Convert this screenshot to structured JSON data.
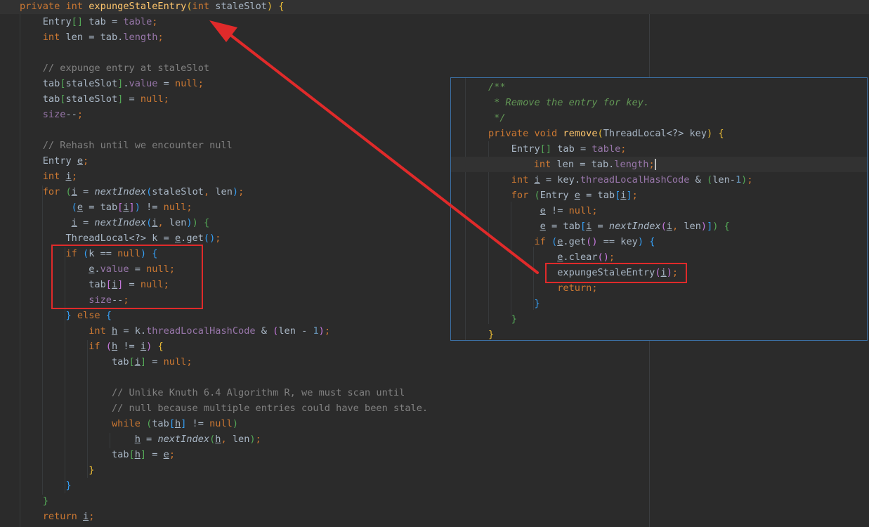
{
  "editor": {
    "main_code": [
      "<span class=\"kw\">private int </span><span class=\"fn\">expungeStaleEntry</span><span class=\"b1\">(</span><span class=\"kw\">int </span>staleSlot<span class=\"b1\">)</span> <span class=\"b1\">{</span>",
      "    Entry<span class=\"b2\">[]</span> tab = <span class=\"fld\">table</span><span class=\"kw\">;</span>",
      "    <span class=\"kw\">int </span>len = tab.<span class=\"fld\">length</span><span class=\"kw\">;</span>",
      "",
      "    <span class=\"cm\">// expunge entry at staleSlot</span>",
      "    tab<span class=\"b2\">[</span>staleSlot<span class=\"b2\">]</span>.<span class=\"fld\">value</span> = <span class=\"kw\">null;</span>",
      "    tab<span class=\"b2\">[</span>staleSlot<span class=\"b2\">]</span> = <span class=\"kw\">null;</span>",
      "    <span class=\"fld\">size</span>--<span class=\"kw\">;</span>",
      "",
      "    <span class=\"cm\">// Rehash until we encounter null</span>",
      "    Entry <span class=\"ul\">e</span><span class=\"kw\">;</span>",
      "    <span class=\"kw\">int </span><span class=\"ul\">i</span><span class=\"kw\">;</span>",
      "    <span class=\"kw\">for </span><span class=\"b2\">(</span><span class=\"ul\">i</span> = <span class=\"it\">nextIndex</span><span class=\"b3\">(</span>staleSlot<span class=\"kw\">, </span>len<span class=\"b3\">)</span><span class=\"kw\">;</span>",
      "         <span class=\"b3\">(</span><span class=\"ul\">e</span> = tab<span class=\"b4\">[</span><span class=\"ul\">i</span><span class=\"b4\">]</span><span class=\"b3\">)</span> != <span class=\"kw\">null;</span>",
      "         <span class=\"ul\">i</span> = <span class=\"it\">nextIndex</span><span class=\"b3\">(</span><span class=\"ul\">i</span><span class=\"kw\">, </span>len<span class=\"b3\">)</span><span class=\"b2\">)</span> <span class=\"b2\">{</span>",
      "        ThreadLocal&lt;?&gt; k = <span class=\"ul\">e</span>.get<span class=\"b3\">()</span><span class=\"kw\">;</span>",
      "        <span class=\"kw\">if </span><span class=\"b3\">(</span>k == <span class=\"kw\">null</span><span class=\"b3\">)</span> <span class=\"b3\">{</span>",
      "            <span class=\"ul\">e</span>.<span class=\"fld\">value</span> = <span class=\"kw\">null;</span>",
      "            tab<span class=\"b4\">[</span><span class=\"ul\">i</span><span class=\"b4\">]</span> = <span class=\"kw\">null;</span>",
      "            <span class=\"fld\">size</span>--<span class=\"kw\">;</span>",
      "        <span class=\"b3\">}</span> <span class=\"kw\">else </span><span class=\"b3\">{</span>",
      "            <span class=\"kw\">int </span><span class=\"ul\">h</span> = k.<span class=\"fld\">threadLocalHashCode</span> &amp; <span class=\"b4\">(</span>len - <span class=\"num\">1</span><span class=\"b4\">)</span><span class=\"kw\">;</span>",
      "            <span class=\"kw\">if </span><span class=\"b4\">(</span><span class=\"ul\">h</span> != <span class=\"ul\">i</span><span class=\"b4\">)</span> <span class=\"b1\">{</span>",
      "                tab<span class=\"b2\">[</span><span class=\"ul\">i</span><span class=\"b2\">]</span> = <span class=\"kw\">null;</span>",
      "",
      "                <span class=\"cm\">// Unlike Knuth 6.4 Algorithm R, we must scan until</span>",
      "                <span class=\"cm\">// null because multiple entries could have been stale.</span>",
      "                <span class=\"kw\">while </span><span class=\"b2\">(</span>tab<span class=\"b3\">[</span><span class=\"ul\">h</span><span class=\"b3\">]</span> != <span class=\"kw\">null</span><span class=\"b2\">)</span>",
      "                    <span class=\"ul\">h</span> = <span class=\"it\">nextIndex</span><span class=\"b2\">(</span><span class=\"ul\">h</span><span class=\"kw\">, </span>len<span class=\"b2\">)</span><span class=\"kw\">;</span>",
      "                tab<span class=\"b2\">[</span><span class=\"ul\">h</span><span class=\"b2\">]</span> = <span class=\"ul\">e</span><span class=\"kw\">;</span>",
      "            <span class=\"b1\">}</span>",
      "        <span class=\"b3\">}</span>",
      "    <span class=\"b2\">}</span>",
      "    <span class=\"kw\">return </span><span class=\"ul\">i</span><span class=\"kw\">;</span>"
    ],
    "popup_code": [
      "<span class=\"dc\">/**</span>",
      "<span class=\"dc\"> * Remove the entry for key.</span>",
      "<span class=\"dc\"> */</span>",
      "<span class=\"kw\">private void </span><span class=\"fn\">remove</span><span class=\"b1\">(</span>ThreadLocal&lt;?&gt; key<span class=\"b1\">)</span> <span class=\"b1\">{</span>",
      "    Entry<span class=\"b2\">[]</span> tab = <span class=\"fld\">table</span><span class=\"kw\">;</span>",
      "    <span class=\"kw\">int </span>len = tab.<span class=\"fld\">length</span><span class=\"kw\">;</span><span class=\"caret\"></span>",
      "    <span class=\"kw\">int </span><span class=\"ul\">i</span> = key.<span class=\"fld\">threadLocalHashCode</span> &amp; <span class=\"b2\">(</span>len-<span class=\"num\">1</span><span class=\"b2\">)</span><span class=\"kw\">;</span>",
      "    <span class=\"kw\">for </span><span class=\"b2\">(</span>Entry <span class=\"ul\">e</span> = tab<span class=\"b3\">[</span><span class=\"ul\">i</span><span class=\"b3\">]</span><span class=\"kw\">;</span>",
      "         <span class=\"ul\">e</span> != <span class=\"kw\">null;</span>",
      "         <span class=\"ul\">e</span> = tab<span class=\"b3\">[</span><span class=\"ul\">i</span> = <span class=\"it\">nextIndex</span><span class=\"b4\">(</span><span class=\"ul\">i</span><span class=\"kw\">, </span>len<span class=\"b4\">)</span><span class=\"b3\">]</span><span class=\"b2\">)</span> <span class=\"b2\">{</span>",
      "        <span class=\"kw\">if </span><span class=\"b3\">(</span><span class=\"ul\">e</span>.get<span class=\"b4\">()</span> == key<span class=\"b3\">)</span> <span class=\"b3\">{</span>",
      "            <span class=\"ul\">e</span>.clear<span class=\"b4\">()</span><span class=\"kw\">;</span>",
      "            expungeStaleEntry<span class=\"b4\">(</span><span class=\"ul\">i</span><span class=\"b4\">)</span><span class=\"kw\">;</span>",
      "            <span class=\"kw\">return;</span>",
      "        <span class=\"b3\">}</span>",
      "    <span class=\"b2\">}</span>",
      "<span class=\"b1\">}</span>"
    ]
  },
  "colors": {
    "background": "#2b2b2b",
    "keyword": "#cc7832",
    "method_decl": "#ffc66d",
    "field": "#9876aa",
    "comment": "#808080",
    "doc_comment": "#629755",
    "number": "#6897bb",
    "annotation_red": "#e02a2a",
    "popup_border": "#3c70a4"
  }
}
